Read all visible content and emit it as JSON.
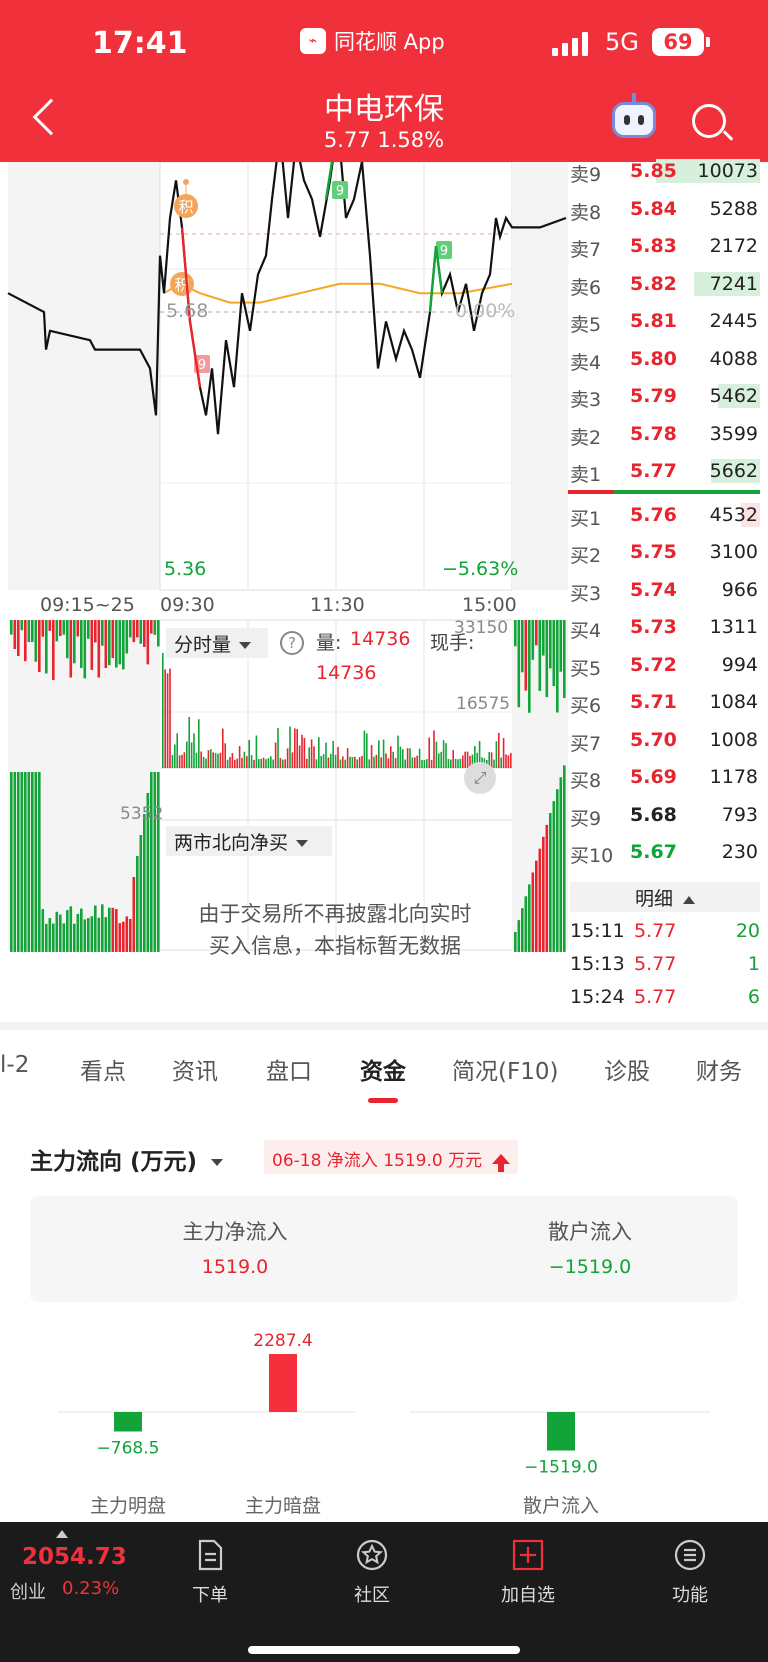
{
  "status_bar": {
    "time": "17:41",
    "app_label": "同花顺 App",
    "network": "5G",
    "battery": "69"
  },
  "header": {
    "title": "中电环保",
    "subtitle": "5.77 1.58%"
  },
  "chart": {
    "price_label_low": "5.36",
    "pct_label_low": "−5.63%",
    "ref_price_label": "5.68",
    "ref_pct_label": "0.00%",
    "time_ticks": [
      "09:15~25",
      "09:30",
      "11:30",
      "15:00"
    ],
    "markers": {
      "ji": "积",
      "nine": "9"
    },
    "avg_line_color": "#f5a623",
    "up_color": "#e8242e",
    "down_color": "#12a339"
  },
  "volume_panel": {
    "selector": "分时量",
    "help_icon": "?",
    "label": "量:",
    "value": "14736",
    "value_2": "14736",
    "xs_label": "现手:",
    "max": "33150",
    "mid": "16575",
    "left_label": "5352"
  },
  "northbound": {
    "selector": "两市北向净买",
    "message_line1": "由于交易所不再披露北向实时",
    "message_line2": "买入信息，本指标暂无数据"
  },
  "order_book": {
    "sell": [
      {
        "label": "卖9",
        "price": "5.85",
        "volume": "10073",
        "bar": 0.55
      },
      {
        "label": "卖8",
        "price": "5.84",
        "volume": "5288",
        "bar": 0
      },
      {
        "label": "卖7",
        "price": "5.83",
        "volume": "2172",
        "bar": 0
      },
      {
        "label": "卖6",
        "price": "5.82",
        "volume": "7241",
        "bar": 0.35
      },
      {
        "label": "卖5",
        "price": "5.81",
        "volume": "2445",
        "bar": 0
      },
      {
        "label": "卖4",
        "price": "5.80",
        "volume": "4088",
        "bar": 0
      },
      {
        "label": "卖3",
        "price": "5.79",
        "volume": "5462",
        "bar": 0.22
      },
      {
        "label": "卖2",
        "price": "5.78",
        "volume": "3599",
        "bar": 0
      },
      {
        "label": "卖1",
        "price": "5.77",
        "volume": "5662",
        "bar": 0.26
      }
    ],
    "buy": [
      {
        "label": "买1",
        "price": "5.76",
        "volume": "4532",
        "bar": 0.1
      },
      {
        "label": "买2",
        "price": "5.75",
        "volume": "3100",
        "bar": 0
      },
      {
        "label": "买3",
        "price": "5.74",
        "volume": "966",
        "bar": 0
      },
      {
        "label": "买4",
        "price": "5.73",
        "volume": "1311",
        "bar": 0
      },
      {
        "label": "买5",
        "price": "5.72",
        "volume": "994",
        "bar": 0
      },
      {
        "label": "买6",
        "price": "5.71",
        "volume": "1084",
        "bar": 0
      },
      {
        "label": "买7",
        "price": "5.70",
        "volume": "1008",
        "bar": 0
      },
      {
        "label": "买8",
        "price": "5.69",
        "volume": "1178",
        "bar": 0
      },
      {
        "label": "买9",
        "price": "5.68",
        "volume": "793",
        "bar": 0
      },
      {
        "label": "买10",
        "price": "5.67",
        "volume": "230",
        "bar": 0
      }
    ],
    "detail_label": "明细",
    "trades": [
      {
        "time": "15:11",
        "price": "5.77",
        "volume": "20"
      },
      {
        "time": "15:13",
        "price": "5.77",
        "volume": "1"
      },
      {
        "time": "15:24",
        "price": "5.77",
        "volume": "6"
      }
    ]
  },
  "tabs": [
    "l-2",
    "看点",
    "资讯",
    "盘口",
    "资金",
    "简况(F10)",
    "诊股",
    "财务"
  ],
  "active_tab": "资金",
  "flow": {
    "title": "主力流向 (万元)",
    "badge": "06-18 净流入 1519.0 万元",
    "card": {
      "main_label": "主力净流入",
      "main_value": "1519.0",
      "retail_label": "散户流入",
      "retail_value": "−1519.0"
    },
    "bars": [
      {
        "label": "主力明盘",
        "value": -768.5,
        "text": "−768.5"
      },
      {
        "label": "主力暗盘",
        "value": 2287.4,
        "text": "2287.4"
      },
      {
        "label": "散户流入",
        "value": -1519.0,
        "text": "−1519.0"
      }
    ]
  },
  "bottom_nav": {
    "index_value": "2054.73",
    "index_name": "创业",
    "index_pct": "0.23%",
    "items": [
      "下单",
      "社区",
      "加自选",
      "功能"
    ]
  }
}
